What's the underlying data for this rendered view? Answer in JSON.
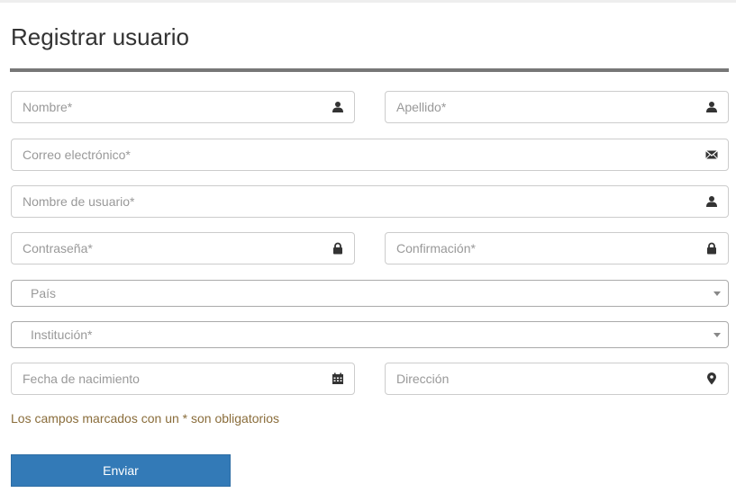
{
  "form": {
    "title": "Registrar usuario",
    "fields": {
      "nombre": {
        "placeholder": "Nombre*",
        "value": "",
        "icon": "user-icon"
      },
      "apellido": {
        "placeholder": "Apellido*",
        "value": "",
        "icon": "user-icon"
      },
      "correo": {
        "placeholder": "Correo electrónico*",
        "value": "",
        "icon": "envelope-icon"
      },
      "usuario": {
        "placeholder": "Nombre de usuario*",
        "value": "",
        "icon": "user-icon"
      },
      "contrasena": {
        "placeholder": "Contraseña*",
        "value": "",
        "icon": "lock-icon"
      },
      "confirmacion": {
        "placeholder": "Confirmación*",
        "value": "",
        "icon": "lock-icon"
      },
      "fecha": {
        "placeholder": "Fecha de nacimiento",
        "value": "",
        "icon": "calendar-icon"
      },
      "direccion": {
        "placeholder": "Dirección",
        "value": "",
        "icon": "map-marker-icon"
      }
    },
    "selects": {
      "pais": {
        "selected": "País"
      },
      "institucion": {
        "selected": "Institución*"
      }
    },
    "required_note": "Los campos marcados con un * son obligatorios",
    "submit_label": "Enviar"
  },
  "colors": {
    "primary_button": "#337ab7",
    "note_text": "#8a6d3b",
    "rule": "#777777"
  }
}
